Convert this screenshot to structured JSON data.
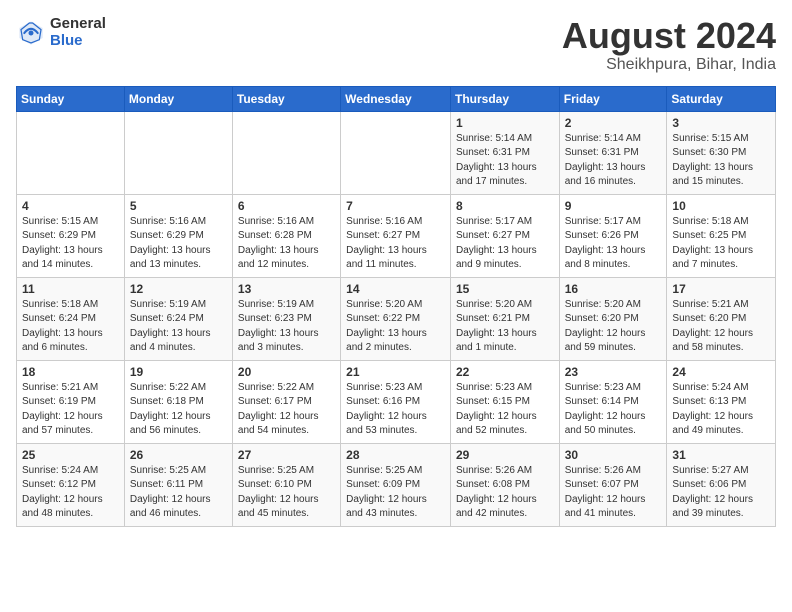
{
  "header": {
    "logo_general": "General",
    "logo_blue": "Blue",
    "month_title": "August 2024",
    "location": "Sheikhpura, Bihar, India"
  },
  "weekdays": [
    "Sunday",
    "Monday",
    "Tuesday",
    "Wednesday",
    "Thursday",
    "Friday",
    "Saturday"
  ],
  "weeks": [
    [
      {
        "day": "",
        "info": ""
      },
      {
        "day": "",
        "info": ""
      },
      {
        "day": "",
        "info": ""
      },
      {
        "day": "",
        "info": ""
      },
      {
        "day": "1",
        "info": "Sunrise: 5:14 AM\nSunset: 6:31 PM\nDaylight: 13 hours\nand 17 minutes."
      },
      {
        "day": "2",
        "info": "Sunrise: 5:14 AM\nSunset: 6:31 PM\nDaylight: 13 hours\nand 16 minutes."
      },
      {
        "day": "3",
        "info": "Sunrise: 5:15 AM\nSunset: 6:30 PM\nDaylight: 13 hours\nand 15 minutes."
      }
    ],
    [
      {
        "day": "4",
        "info": "Sunrise: 5:15 AM\nSunset: 6:29 PM\nDaylight: 13 hours\nand 14 minutes."
      },
      {
        "day": "5",
        "info": "Sunrise: 5:16 AM\nSunset: 6:29 PM\nDaylight: 13 hours\nand 13 minutes."
      },
      {
        "day": "6",
        "info": "Sunrise: 5:16 AM\nSunset: 6:28 PM\nDaylight: 13 hours\nand 12 minutes."
      },
      {
        "day": "7",
        "info": "Sunrise: 5:16 AM\nSunset: 6:27 PM\nDaylight: 13 hours\nand 11 minutes."
      },
      {
        "day": "8",
        "info": "Sunrise: 5:17 AM\nSunset: 6:27 PM\nDaylight: 13 hours\nand 9 minutes."
      },
      {
        "day": "9",
        "info": "Sunrise: 5:17 AM\nSunset: 6:26 PM\nDaylight: 13 hours\nand 8 minutes."
      },
      {
        "day": "10",
        "info": "Sunrise: 5:18 AM\nSunset: 6:25 PM\nDaylight: 13 hours\nand 7 minutes."
      }
    ],
    [
      {
        "day": "11",
        "info": "Sunrise: 5:18 AM\nSunset: 6:24 PM\nDaylight: 13 hours\nand 6 minutes."
      },
      {
        "day": "12",
        "info": "Sunrise: 5:19 AM\nSunset: 6:24 PM\nDaylight: 13 hours\nand 4 minutes."
      },
      {
        "day": "13",
        "info": "Sunrise: 5:19 AM\nSunset: 6:23 PM\nDaylight: 13 hours\nand 3 minutes."
      },
      {
        "day": "14",
        "info": "Sunrise: 5:20 AM\nSunset: 6:22 PM\nDaylight: 13 hours\nand 2 minutes."
      },
      {
        "day": "15",
        "info": "Sunrise: 5:20 AM\nSunset: 6:21 PM\nDaylight: 13 hours\nand 1 minute."
      },
      {
        "day": "16",
        "info": "Sunrise: 5:20 AM\nSunset: 6:20 PM\nDaylight: 12 hours\nand 59 minutes."
      },
      {
        "day": "17",
        "info": "Sunrise: 5:21 AM\nSunset: 6:20 PM\nDaylight: 12 hours\nand 58 minutes."
      }
    ],
    [
      {
        "day": "18",
        "info": "Sunrise: 5:21 AM\nSunset: 6:19 PM\nDaylight: 12 hours\nand 57 minutes."
      },
      {
        "day": "19",
        "info": "Sunrise: 5:22 AM\nSunset: 6:18 PM\nDaylight: 12 hours\nand 56 minutes."
      },
      {
        "day": "20",
        "info": "Sunrise: 5:22 AM\nSunset: 6:17 PM\nDaylight: 12 hours\nand 54 minutes."
      },
      {
        "day": "21",
        "info": "Sunrise: 5:23 AM\nSunset: 6:16 PM\nDaylight: 12 hours\nand 53 minutes."
      },
      {
        "day": "22",
        "info": "Sunrise: 5:23 AM\nSunset: 6:15 PM\nDaylight: 12 hours\nand 52 minutes."
      },
      {
        "day": "23",
        "info": "Sunrise: 5:23 AM\nSunset: 6:14 PM\nDaylight: 12 hours\nand 50 minutes."
      },
      {
        "day": "24",
        "info": "Sunrise: 5:24 AM\nSunset: 6:13 PM\nDaylight: 12 hours\nand 49 minutes."
      }
    ],
    [
      {
        "day": "25",
        "info": "Sunrise: 5:24 AM\nSunset: 6:12 PM\nDaylight: 12 hours\nand 48 minutes."
      },
      {
        "day": "26",
        "info": "Sunrise: 5:25 AM\nSunset: 6:11 PM\nDaylight: 12 hours\nand 46 minutes."
      },
      {
        "day": "27",
        "info": "Sunrise: 5:25 AM\nSunset: 6:10 PM\nDaylight: 12 hours\nand 45 minutes."
      },
      {
        "day": "28",
        "info": "Sunrise: 5:25 AM\nSunset: 6:09 PM\nDaylight: 12 hours\nand 43 minutes."
      },
      {
        "day": "29",
        "info": "Sunrise: 5:26 AM\nSunset: 6:08 PM\nDaylight: 12 hours\nand 42 minutes."
      },
      {
        "day": "30",
        "info": "Sunrise: 5:26 AM\nSunset: 6:07 PM\nDaylight: 12 hours\nand 41 minutes."
      },
      {
        "day": "31",
        "info": "Sunrise: 5:27 AM\nSunset: 6:06 PM\nDaylight: 12 hours\nand 39 minutes."
      }
    ]
  ]
}
